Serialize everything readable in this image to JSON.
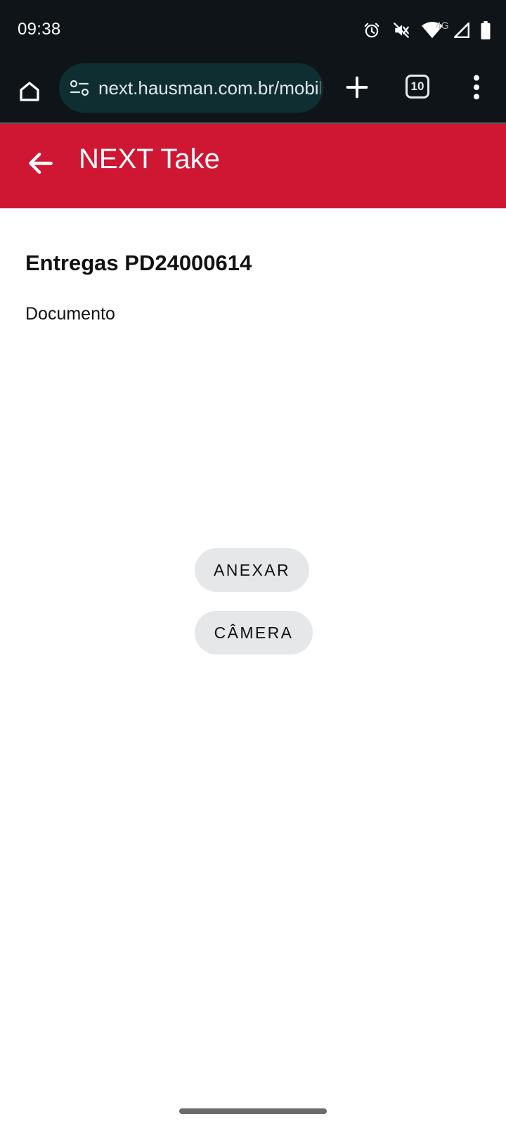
{
  "status_bar": {
    "time": "09:38",
    "network_label": "4G",
    "icons": [
      "alarm-icon",
      "vibrate-off-icon",
      "wifi-icon",
      "cell-signal-icon",
      "battery-icon"
    ]
  },
  "browser": {
    "url": "next.hausman.com.br/mobile",
    "tab_count": "10",
    "icons": [
      "home-icon",
      "site-settings-icon",
      "plus-icon",
      "tabs-icon",
      "more-vert-icon"
    ]
  },
  "app_bar": {
    "title": "NEXT Take",
    "color": "#cf1733",
    "back_icon": "arrow-back-icon"
  },
  "content": {
    "heading": "Entregas PD24000614",
    "document_label": "Documento"
  },
  "actions": {
    "attach_label": "ANEXAR",
    "camera_label": "CÂMERA"
  }
}
